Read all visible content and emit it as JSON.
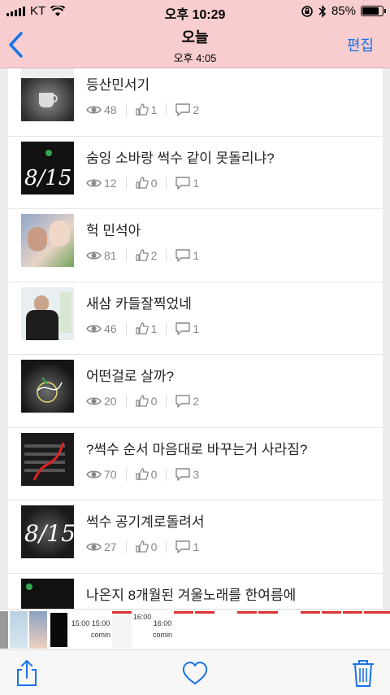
{
  "status_bar": {
    "carrier": "KT",
    "time": "오후 10:29",
    "battery": "85%",
    "battery_level": 0.85
  },
  "nav": {
    "title": "오늘",
    "subtitle": "오후 4:05",
    "edit_label": "편집",
    "accent_color": "#1a73e8",
    "bar_color": "#f7cdcf"
  },
  "posts": [
    {
      "title": "등산민서기",
      "views": "48",
      "likes": "1",
      "comments": "2",
      "thumb": "cup-dark"
    },
    {
      "title": "숨잉 소바랑 썩수 같이 못돌리냐?",
      "views": "12",
      "likes": "0",
      "comments": "1",
      "thumb": "handwriting-815"
    },
    {
      "title": "헉 민석아",
      "views": "81",
      "likes": "2",
      "comments": "1",
      "thumb": "two-people"
    },
    {
      "title": "새삼 카들잘찍었네",
      "views": "46",
      "likes": "1",
      "comments": "1",
      "thumb": "person-suit"
    },
    {
      "title": "어떤걸로 살까?",
      "views": "20",
      "likes": "0",
      "comments": "2",
      "thumb": "cup-scribble"
    },
    {
      "title": "?썩수 순서 마음대로 바꾸는거 사라짐?",
      "views": "70",
      "likes": "0",
      "comments": "3",
      "thumb": "phone-list-red"
    },
    {
      "title": "썩수 공기계로돌려서",
      "views": "27",
      "likes": "0",
      "comments": "1",
      "thumb": "handwriting-815-b"
    },
    {
      "title": "나온지 8개월된 겨울노래를 한여름에",
      "views": "",
      "likes": "",
      "comments": "",
      "thumb": "phone-screen"
    }
  ],
  "filmstrip": {
    "labels": [
      "15:00",
      "15:00",
      "16:00",
      "16:00"
    ],
    "texts": [
      "coming",
      "coming"
    ]
  },
  "toolbar": {
    "share": "share-icon",
    "favorite": "heart-icon",
    "delete": "trash-icon"
  }
}
